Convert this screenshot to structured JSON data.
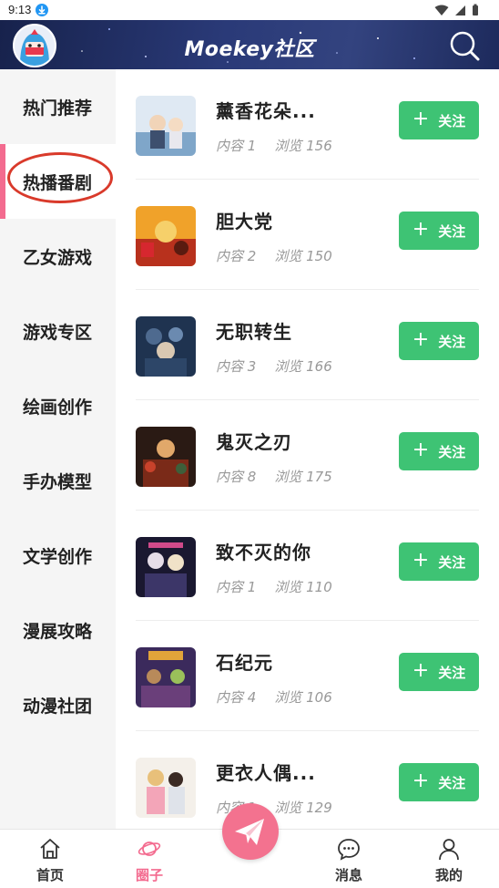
{
  "status_bar": {
    "time": "9:13"
  },
  "header": {
    "title": "Moekey社区"
  },
  "sidebar": {
    "items": [
      {
        "label": "热门推荐",
        "active": false
      },
      {
        "label": "热播番剧",
        "active": true
      },
      {
        "label": "乙女游戏",
        "active": false
      },
      {
        "label": "游戏专区",
        "active": false
      },
      {
        "label": "绘画创作",
        "active": false
      },
      {
        "label": "手办模型",
        "active": false
      },
      {
        "label": "文学创作",
        "active": false
      },
      {
        "label": "漫展攻略",
        "active": false
      },
      {
        "label": "动漫社团",
        "active": false
      }
    ]
  },
  "communities": [
    {
      "title": "薰香花朵...",
      "content_label": "内容",
      "content": "1",
      "views_label": "浏览",
      "views": "156",
      "follow_label": "关注"
    },
    {
      "title": "胆大党",
      "content_label": "内容",
      "content": "2",
      "views_label": "浏览",
      "views": "150",
      "follow_label": "关注"
    },
    {
      "title": "无职转生",
      "content_label": "内容",
      "content": "3",
      "views_label": "浏览",
      "views": "166",
      "follow_label": "关注"
    },
    {
      "title": "鬼灭之刃",
      "content_label": "内容",
      "content": "8",
      "views_label": "浏览",
      "views": "175",
      "follow_label": "关注"
    },
    {
      "title": "致不灭的你",
      "content_label": "内容",
      "content": "1",
      "views_label": "浏览",
      "views": "110",
      "follow_label": "关注"
    },
    {
      "title": "石纪元",
      "content_label": "内容",
      "content": "4",
      "views_label": "浏览",
      "views": "106",
      "follow_label": "关注"
    },
    {
      "title": "更衣人偶...",
      "content_label": "内容",
      "content": "1",
      "views_label": "浏览",
      "views": "129",
      "follow_label": "关注"
    }
  ],
  "bottom_nav": {
    "home": "首页",
    "circle": "圈子",
    "messages": "消息",
    "mine": "我的"
  },
  "colors": {
    "accent_pink": "#f3728f",
    "follow_green": "#3ec374",
    "annotation_red": "#d93a2b"
  }
}
